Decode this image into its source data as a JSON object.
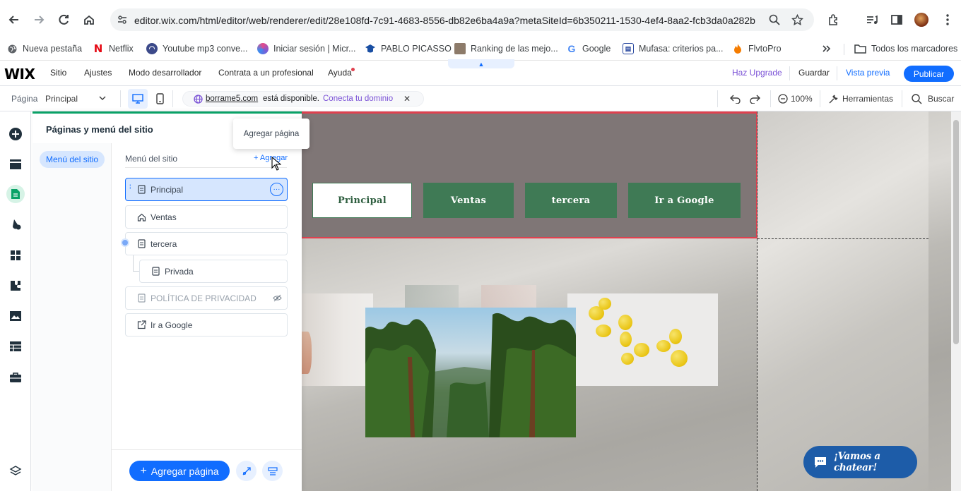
{
  "browser": {
    "url": "editor.wix.com/html/editor/web/renderer/edit/28e108fd-7c91-4683-8556-db82e6ba4a9a?metaSiteId=6b350211-1530-4ef4-8aa2-fcb3da0a282b",
    "bookmarks": [
      {
        "label": "Nueva pestaña",
        "icon": "globe-icon",
        "color": "#5f6368"
      },
      {
        "label": "Netflix",
        "icon": "netflix-icon",
        "color": "#e50914"
      },
      {
        "label": "Youtube mp3 conve...",
        "icon": "headphones-icon",
        "color": "#3c4a8a"
      },
      {
        "label": "Iniciar sesión | Micr...",
        "icon": "microsoft-icon",
        "color": "#7b5cd6"
      },
      {
        "label": "PABLO PICASSO",
        "icon": "graduation-icon",
        "color": "#1a4fa3"
      },
      {
        "label": "Ranking de las mejo...",
        "icon": "image-icon",
        "color": "#8d7b6a"
      },
      {
        "label": "Google",
        "icon": "google-icon",
        "color": "#4285f4"
      },
      {
        "label": "Mufasa: criterios pa...",
        "icon": "doc-icon",
        "color": "#2b4aa0"
      },
      {
        "label": "FlvtoPro",
        "icon": "flame-icon",
        "color": "#f57c00"
      }
    ],
    "all_bookmarks": "Todos los marcadores"
  },
  "wix": {
    "logo": "WIX",
    "menu": [
      "Sitio",
      "Ajustes",
      "Modo desarrollador",
      "Contrata a un profesional",
      "Ayuda"
    ],
    "upgrade": "Haz Upgrade",
    "save": "Guardar",
    "preview": "Vista previa",
    "publish": "Publicar",
    "toolbar": {
      "page_label": "Página",
      "page_value": "Principal",
      "domain": "borrame5.com",
      "domain_status": "está disponible.",
      "domain_cta": "Conecta tu dominio",
      "zoom": "100%",
      "tools": "Herramientas",
      "search": "Buscar"
    }
  },
  "panel": {
    "title": "Páginas y menú del sitio",
    "side_tab": "Menú del sitio",
    "menu_heading": "Menú del sitio",
    "add_link": "+ Agregar",
    "tooltip": "Agregar página",
    "pages": [
      {
        "label": "Principal",
        "icon": "page-icon",
        "state": "selected"
      },
      {
        "label": "Ventas",
        "icon": "home-icon",
        "state": "normal"
      },
      {
        "label": "tercera",
        "icon": "page-icon",
        "state": "normal"
      },
      {
        "label": "Privada",
        "icon": "page-icon",
        "state": "subpage"
      },
      {
        "label": "POLÍTICA DE PRIVACIDAD",
        "icon": "page-icon",
        "state": "hidden"
      },
      {
        "label": "Ir a Google",
        "icon": "external-link-icon",
        "state": "link"
      }
    ],
    "add_page_button": "Agregar página"
  },
  "site": {
    "nav": [
      "Principal",
      "Ventas",
      "tercera",
      "Ir a Google"
    ],
    "chat": "¡Vamos a chatear!"
  },
  "colors": {
    "accent": "#116dff",
    "panel_accent": "#0aa267",
    "site_nav": "#3f7a55",
    "header_bg": "#7f7676",
    "selection": "#e0414f"
  }
}
